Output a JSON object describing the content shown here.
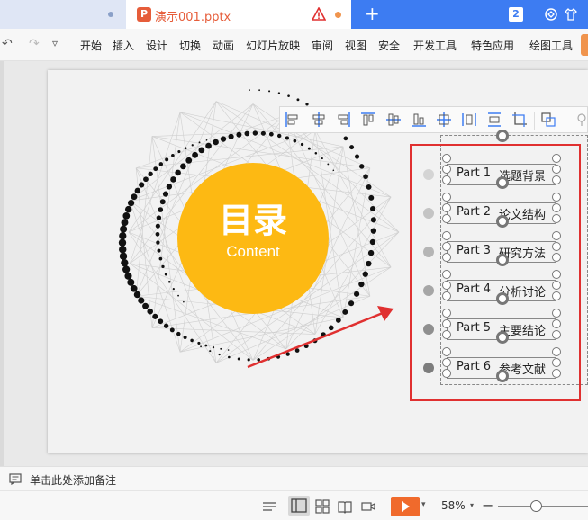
{
  "titlebar": {
    "tab_title": "演示001.pptx",
    "app_logo_letter": "P",
    "window_count": "2",
    "accent_color": "#3d7cf2",
    "logo_color": "#e65d3a"
  },
  "ribbon": {
    "tabs": [
      "开始",
      "插入",
      "设计",
      "切换",
      "动画",
      "幻灯片放映",
      "审阅",
      "视图",
      "安全",
      "开发工具",
      "特色应用",
      "绘图工具"
    ]
  },
  "slide": {
    "circle_title": "目录",
    "circle_subtitle": "Content",
    "circle_color": "#fdb913",
    "items": [
      {
        "part": "Part 1",
        "title": "选题背景",
        "bullet_color": "#d4d4d4"
      },
      {
        "part": "Part 2",
        "title": "论文结构",
        "bullet_color": "#c4c4c4"
      },
      {
        "part": "Part 3",
        "title": "研究方法",
        "bullet_color": "#b5b5b5"
      },
      {
        "part": "Part 4",
        "title": "分析讨论",
        "bullet_color": "#a6a6a6"
      },
      {
        "part": "Part 5",
        "title": "主要结论",
        "bullet_color": "#8f8f8f"
      },
      {
        "part": "Part 6",
        "title": "参考文献",
        "bullet_color": "#7d7d7d"
      }
    ],
    "annotation_color": "#e03030"
  },
  "icons": {
    "align_toolbar": [
      "align-left-icon",
      "align-center-icon",
      "align-right-icon",
      "align-top-icon",
      "align-middle-icon",
      "align-bottom-icon",
      "align-both-icon",
      "distribute-horizontal-icon",
      "distribute-vertical-icon",
      "crop-icon",
      "group-icon",
      "more-icon"
    ]
  },
  "notes": {
    "placeholder": "单击此处添加备注"
  },
  "statusbar": {
    "zoom": "58%"
  }
}
